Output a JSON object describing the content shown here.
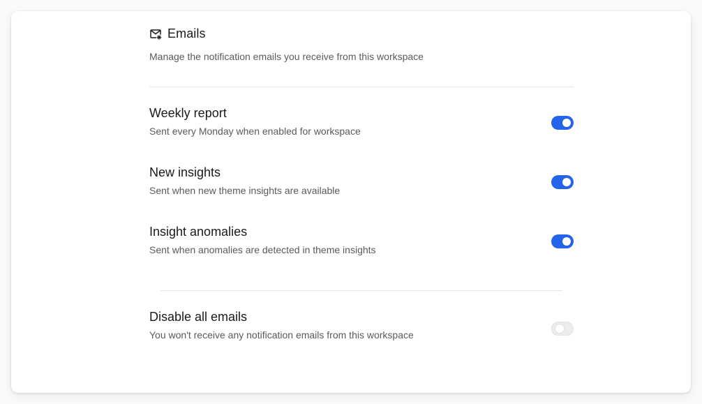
{
  "section": {
    "icon": "mail-settings-icon",
    "title": "Emails",
    "description": "Manage the notification emails you receive from this workspace"
  },
  "settings": [
    {
      "title": "Weekly report",
      "subtitle": "Sent every Monday when enabled for workspace",
      "enabled": true
    },
    {
      "title": "New insights",
      "subtitle": "Sent when new theme insights are available",
      "enabled": true
    },
    {
      "title": "Insight anomalies",
      "subtitle": "Sent when anomalies are detected in theme insights",
      "enabled": true
    }
  ],
  "disable_all": {
    "title": "Disable all emails",
    "subtitle": "You won't receive any notification emails from this workspace",
    "enabled": false
  },
  "colors": {
    "toggle_on": "#2563eb",
    "toggle_off": "#ececec"
  }
}
